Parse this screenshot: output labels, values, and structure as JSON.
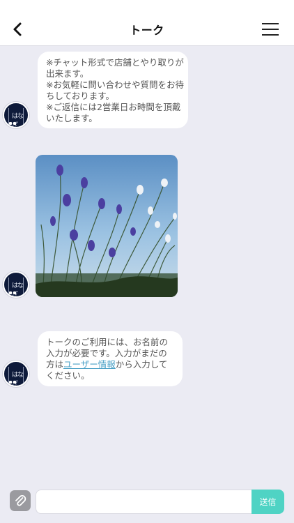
{
  "header": {
    "title": "トーク",
    "back_icon": "chevron-left-icon",
    "menu_icon": "hamburger-menu-icon"
  },
  "avatar": {
    "logo_text": "はなぎ",
    "bg_color": "#0e1a3a"
  },
  "messages": [
    {
      "type": "text",
      "lines": [
        "※チャット形式で店舗とやり取りが",
        "出来ます。",
        "※お気軽に問い合わせや質問をお待",
        "ちしております。",
        "※ご返信には2営業日お時間を頂戴",
        "いたします。"
      ]
    },
    {
      "type": "image",
      "description_icon": "flower-photo"
    },
    {
      "type": "text",
      "line1": "トークのご利用には、お名前の",
      "line2": "入力が必要です。入力がまだの",
      "line3_prefix": "方は",
      "line3_link": "ユーザー情報",
      "line3_suffix": "から入力して",
      "line4": "ください。"
    }
  ],
  "composer": {
    "attach_icon": "paperclip-icon",
    "input_value": "",
    "input_placeholder": "",
    "send_label": "送信",
    "send_color": "#4fd3c4"
  }
}
